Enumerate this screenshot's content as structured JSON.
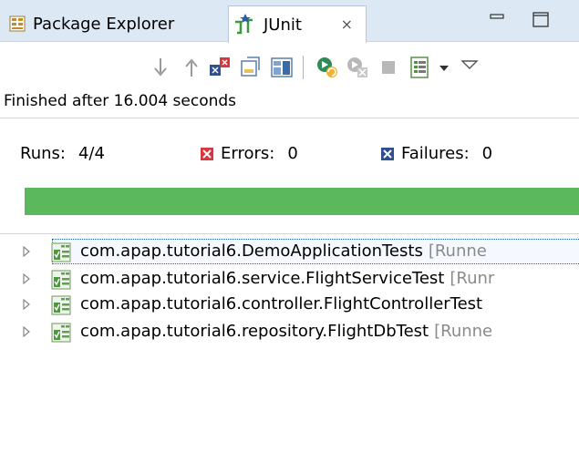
{
  "tabs": {
    "package_explorer": "Package Explorer",
    "junit": "JUnit",
    "junit_close": "⨯"
  },
  "toolbar": {
    "items": [
      "next-failure-icon",
      "previous-failure-icon",
      "show-failures-only-icon",
      "scroll-lock-icon",
      "layout-icon",
      "rerun-icon",
      "rerun-failed-icon",
      "stop-icon",
      "history-icon",
      "history-dropdown-icon",
      "view-menu-icon"
    ]
  },
  "status": "Finished after 16.004 seconds",
  "counters": {
    "runs_label": "Runs:",
    "runs_value": "4/4",
    "errors_label": "Errors:",
    "errors_value": "0",
    "failures_label": "Failures:",
    "failures_value": "0"
  },
  "progress": {
    "fraction": 1.0,
    "color": "#5cb85c"
  },
  "tests": [
    {
      "name": "com.apap.tutorial6.DemoApplicationTests",
      "runner": "[Runne"
    },
    {
      "name": "com.apap.tutorial6.service.FlightServiceTest",
      "runner": "[Runr"
    },
    {
      "name": "com.apap.tutorial6.controller.FlightControllerTest",
      "runner": ""
    },
    {
      "name": "com.apap.tutorial6.repository.FlightDbTest",
      "runner": "[Runne"
    }
  ],
  "colors": {
    "error": "#d9363e",
    "failure": "#2f4f8f",
    "pass": "#5cb85c"
  }
}
